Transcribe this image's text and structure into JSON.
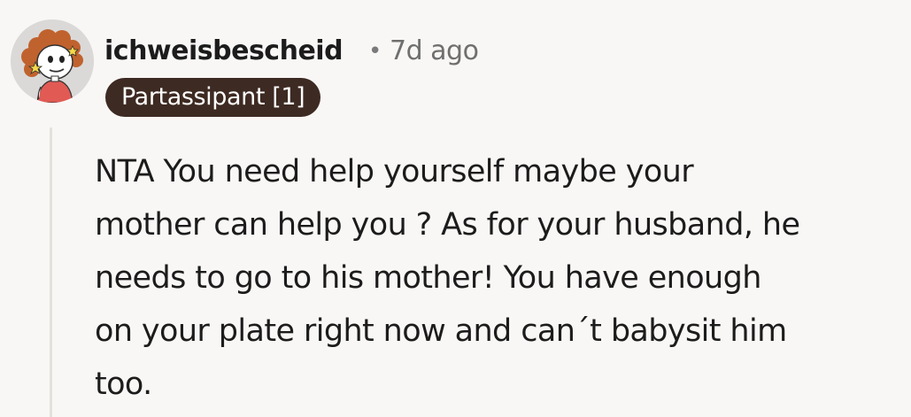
{
  "comment": {
    "author": {
      "username": "ichweisbescheid",
      "avatar_icon": "cartoon-avatar-icon",
      "flair": "Partassipant [1]"
    },
    "separator": "•",
    "timestamp": "7d ago",
    "body_lines": [
      "NTA You need help yourself maybe your",
      "mother can help you ? As for your husband, he",
      "needs to go to his mother! You have enough",
      "on your plate right now and can´t babysit him",
      "too."
    ]
  },
  "colors": {
    "background": "#f9f7f5",
    "flair_background": "#3d2a22",
    "flair_text": "#ffffff",
    "username": "#1c1c1c",
    "timestamp": "#6f6f6f",
    "thread_line": "#e4e0dd"
  }
}
